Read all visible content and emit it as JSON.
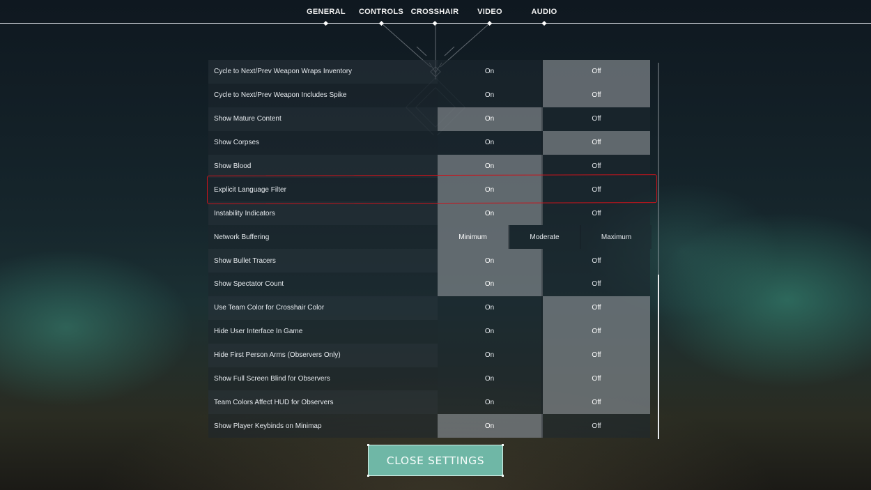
{
  "tabs": [
    {
      "label": "GENERAL"
    },
    {
      "label": "CONTROLS"
    },
    {
      "label": "CROSSHAIR"
    },
    {
      "label": "VIDEO"
    },
    {
      "label": "AUDIO"
    }
  ],
  "settings": [
    {
      "label": "Cycle to Next/Prev Weapon Wraps Inventory",
      "options": [
        "On",
        "Off"
      ],
      "selected": "Off"
    },
    {
      "label": "Cycle to Next/Prev Weapon Includes Spike",
      "options": [
        "On",
        "Off"
      ],
      "selected": "Off"
    },
    {
      "label": "Show Mature Content",
      "options": [
        "On",
        "Off"
      ],
      "selected": "On"
    },
    {
      "label": "Show Corpses",
      "options": [
        "On",
        "Off"
      ],
      "selected": "Off"
    },
    {
      "label": "Show Blood",
      "options": [
        "On",
        "Off"
      ],
      "selected": "On"
    },
    {
      "label": "Explicit Language Filter",
      "options": [
        "On",
        "Off"
      ],
      "selected": "On"
    },
    {
      "label": "Instability Indicators",
      "options": [
        "On",
        "Off"
      ],
      "selected": "On"
    },
    {
      "label": "Network Buffering",
      "options": [
        "Minimum",
        "Moderate",
        "Maximum"
      ],
      "selected": "Minimum"
    },
    {
      "label": "Show Bullet Tracers",
      "options": [
        "On",
        "Off"
      ],
      "selected": "On"
    },
    {
      "label": "Show Spectator Count",
      "options": [
        "On",
        "Off"
      ],
      "selected": "On"
    },
    {
      "label": "Use Team Color for Crosshair Color",
      "options": [
        "On",
        "Off"
      ],
      "selected": "Off"
    },
    {
      "label": "Hide User Interface In Game",
      "options": [
        "On",
        "Off"
      ],
      "selected": "Off"
    },
    {
      "label": "Hide First Person Arms (Observers Only)",
      "options": [
        "On",
        "Off"
      ],
      "selected": "Off"
    },
    {
      "label": "Show Full Screen Blind for Observers",
      "options": [
        "On",
        "Off"
      ],
      "selected": "Off"
    },
    {
      "label": "Team Colors Affect HUD for Observers",
      "options": [
        "On",
        "Off"
      ],
      "selected": "Off"
    },
    {
      "label": "Show Player Keybinds on Minimap",
      "options": [
        "On",
        "Off"
      ],
      "selected": "On"
    }
  ],
  "highlighted_setting": "Explicit Language Filter",
  "close_button": {
    "label": "CLOSE SETTINGS"
  },
  "colors": {
    "accent_button": "#6fb7a6",
    "annotation": "#c8141c",
    "selected_option": "#767c82"
  }
}
